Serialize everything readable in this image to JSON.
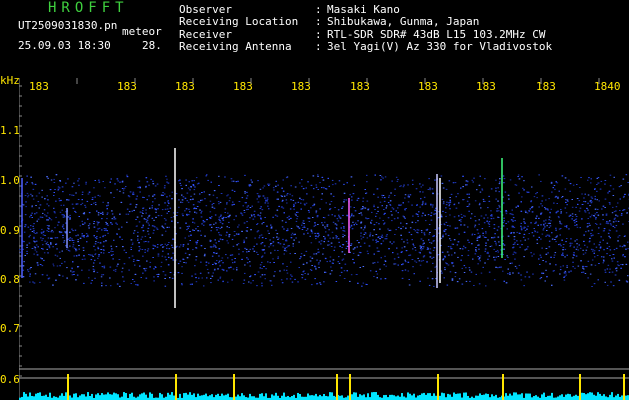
{
  "app": {
    "title": "HROFFT"
  },
  "file": {
    "name": "UT2509031830.pn",
    "datetime": "25.09.03 18:30"
  },
  "meteor": {
    "label": "meteor",
    "count": "28."
  },
  "info": [
    {
      "key": "Observer",
      "value": "Masaki Kano"
    },
    {
      "key": "Receiving Location",
      "value": "Shibukawa, Gunma, Japan"
    },
    {
      "key": "Receiver",
      "value": "RTL-SDR SDR# 43dB L15 103.2MHz CW"
    },
    {
      "key": "Receiving Antenna",
      "value": "3el Yagi(V) Az 330 for Vladivostok"
    }
  ],
  "axis": {
    "unit": "kHz",
    "y_labels": [
      "1.1",
      "1.0",
      "0.9",
      "0.8",
      "0.7",
      "0.6"
    ],
    "time_labels": [
      "183",
      "183",
      "183",
      "183",
      "183",
      "183",
      "183",
      "183",
      "183",
      "1840"
    ]
  },
  "colors": {
    "title": "#3fd13f",
    "labels": "#ffe600",
    "noise": "#1e32c8",
    "level": "#00e5ff"
  }
}
